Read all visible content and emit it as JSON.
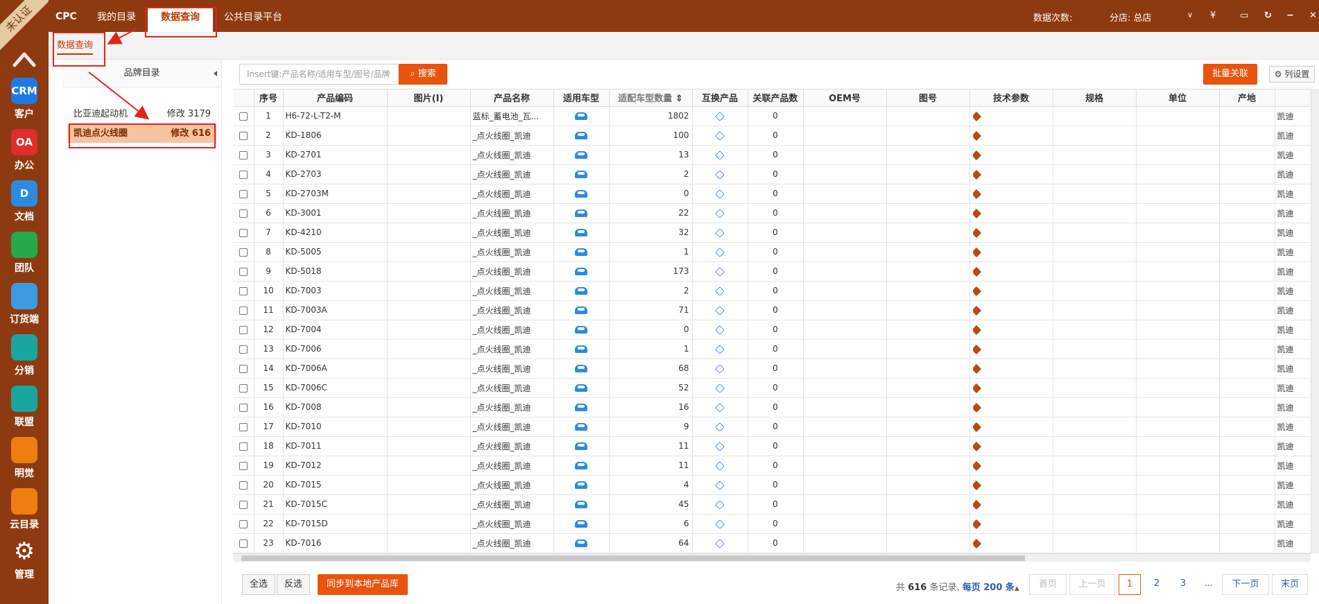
{
  "ribbon": "未认证",
  "rail": [
    {
      "label": "客户",
      "icon": "CRM",
      "color": "#1e78e6"
    },
    {
      "label": "办公",
      "icon": "OA",
      "color": "#e02d2d"
    },
    {
      "label": "文档",
      "icon": "D",
      "color": "#2a8be0"
    },
    {
      "label": "团队",
      "icon": "",
      "color": "#27a84a"
    },
    {
      "label": "订货端",
      "icon": "",
      "color": "#3d9be0"
    },
    {
      "label": "分销",
      "icon": "",
      "color": "#1aa5a0"
    },
    {
      "label": "联盟",
      "icon": "",
      "color": "#1aa5a0"
    },
    {
      "label": "明觉",
      "icon": "",
      "color": "#f07d0f"
    },
    {
      "label": "云目录",
      "icon": "",
      "color": "#f07d0f"
    },
    {
      "label": "管理",
      "icon": "",
      "color": "#8e3a10"
    }
  ],
  "topbar": {
    "brand": "CPC",
    "tabs": [
      "我的目录",
      "数据查询",
      "公共目录平台"
    ],
    "query_count_label": "数据次数:",
    "branch": "分店: 总店",
    "currency_icon": "¥"
  },
  "subtab": "数据查询",
  "brand_panel": {
    "title": "品牌目录",
    "items": [
      {
        "name": "比亚迪起动机",
        "count": "修改 3179"
      },
      {
        "name": "凯迪点火线圈",
        "count": "修改 616"
      }
    ]
  },
  "search": {
    "placeholder": "Insert键:产品名称/适用车型/图号/品牌",
    "button": "搜索"
  },
  "bulk_link": "批量关联",
  "column_settings": "列设置",
  "table": {
    "headers": [
      "序号",
      "产品编码",
      "图片(I)",
      "产品名称",
      "适用车型",
      "适配车型数量",
      "互换产品",
      "关联产品数",
      "OEM号",
      "图号",
      "技术参数",
      "规格",
      "单位",
      "产地"
    ],
    "rows": [
      {
        "no": "1",
        "code": "H6-72-L-T2-M",
        "name": "蓝标_蓄电池_瓦...",
        "qty": "1802",
        "rel": "0",
        "brand": "凯迪"
      },
      {
        "no": "2",
        "code": "KD-1806",
        "name": "_点火线圈_凯迪",
        "qty": "100",
        "rel": "0",
        "brand": "凯迪"
      },
      {
        "no": "3",
        "code": "KD-2701",
        "name": "_点火线圈_凯迪",
        "qty": "13",
        "rel": "0",
        "brand": "凯迪"
      },
      {
        "no": "4",
        "code": "KD-2703",
        "name": "_点火线圈_凯迪",
        "qty": "2",
        "rel": "0",
        "brand": "凯迪"
      },
      {
        "no": "5",
        "code": "KD-2703M",
        "name": "_点火线圈_凯迪",
        "qty": "0",
        "rel": "0",
        "brand": "凯迪"
      },
      {
        "no": "6",
        "code": "KD-3001",
        "name": "_点火线圈_凯迪",
        "qty": "22",
        "rel": "0",
        "brand": "凯迪"
      },
      {
        "no": "7",
        "code": "KD-4210",
        "name": "_点火线圈_凯迪",
        "qty": "32",
        "rel": "0",
        "brand": "凯迪"
      },
      {
        "no": "8",
        "code": "KD-5005",
        "name": "_点火线圈_凯迪",
        "qty": "1",
        "rel": "0",
        "brand": "凯迪"
      },
      {
        "no": "9",
        "code": "KD-5018",
        "name": "_点火线圈_凯迪",
        "qty": "173",
        "rel": "0",
        "brand": "凯迪"
      },
      {
        "no": "10",
        "code": "KD-7003",
        "name": "_点火线圈_凯迪",
        "qty": "2",
        "rel": "0",
        "brand": "凯迪"
      },
      {
        "no": "11",
        "code": "KD-7003A",
        "name": "_点火线圈_凯迪",
        "qty": "71",
        "rel": "0",
        "brand": "凯迪"
      },
      {
        "no": "12",
        "code": "KD-7004",
        "name": "_点火线圈_凯迪",
        "qty": "0",
        "rel": "0",
        "brand": "凯迪"
      },
      {
        "no": "13",
        "code": "KD-7006",
        "name": "_点火线圈_凯迪",
        "qty": "1",
        "rel": "0",
        "brand": "凯迪"
      },
      {
        "no": "14",
        "code": "KD-7006A",
        "name": "_点火线圈_凯迪",
        "qty": "68",
        "rel": "0",
        "brand": "凯迪"
      },
      {
        "no": "15",
        "code": "KD-7006C",
        "name": "_点火线圈_凯迪",
        "qty": "52",
        "rel": "0",
        "brand": "凯迪"
      },
      {
        "no": "16",
        "code": "KD-7008",
        "name": "_点火线圈_凯迪",
        "qty": "16",
        "rel": "0",
        "brand": "凯迪"
      },
      {
        "no": "17",
        "code": "KD-7010",
        "name": "_点火线圈_凯迪",
        "qty": "9",
        "rel": "0",
        "brand": "凯迪"
      },
      {
        "no": "18",
        "code": "KD-7011",
        "name": "_点火线圈_凯迪",
        "qty": "11",
        "rel": "0",
        "brand": "凯迪"
      },
      {
        "no": "19",
        "code": "KD-7012",
        "name": "_点火线圈_凯迪",
        "qty": "11",
        "rel": "0",
        "brand": "凯迪"
      },
      {
        "no": "20",
        "code": "KD-7015",
        "name": "_点火线圈_凯迪",
        "qty": "4",
        "rel": "0",
        "brand": "凯迪"
      },
      {
        "no": "21",
        "code": "KD-7015C",
        "name": "_点火线圈_凯迪",
        "qty": "45",
        "rel": "0",
        "brand": "凯迪"
      },
      {
        "no": "22",
        "code": "KD-7015D",
        "name": "_点火线圈_凯迪",
        "qty": "6",
        "rel": "0",
        "brand": "凯迪"
      },
      {
        "no": "23",
        "code": "KD-7016",
        "name": "_点火线圈_凯迪",
        "qty": "64",
        "rel": "0",
        "brand": "凯迪"
      }
    ]
  },
  "footer": {
    "select_all": "全选",
    "invert": "反选",
    "sync": "同步到本地产品库",
    "summary_prefix": "共",
    "total": "616",
    "summary_mid": "条记录,",
    "per_page": "每页 200 条",
    "pages": [
      "首页",
      "上一页",
      "1",
      "2",
      "3",
      "...",
      "下一页",
      "末页"
    ]
  }
}
